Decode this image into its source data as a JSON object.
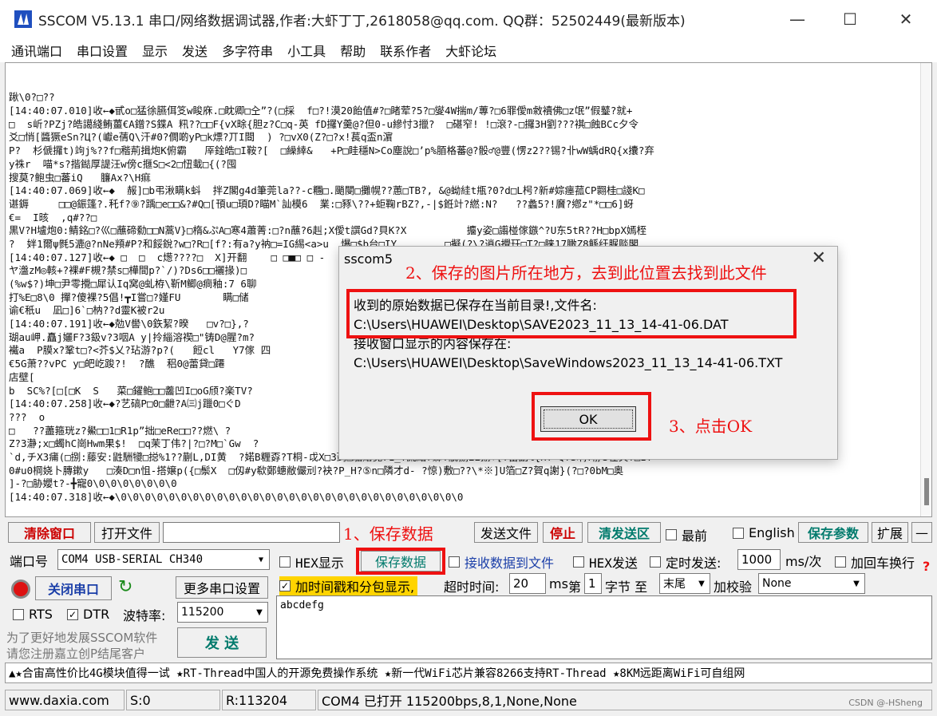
{
  "window": {
    "title": "SSCOM V5.13.1 串口/网络数据调试器,作者:大虾丁丁,2618058@qq.com. QQ群：52502449(最新版本)",
    "minimize": "—",
    "maximize": "☐",
    "close": "✕"
  },
  "menu": [
    "通讯端口",
    "串口设置",
    "显示",
    "发送",
    "多字符串",
    "小工具",
    "帮助",
    "联系作者",
    "大虾论坛"
  ],
  "receive_lines": [
    "踿\\0?□??",
    "[14:40:07.010]收←◆甙o□猛徐臙佴笅w睃庥.□眈卿□㒰”?(□採  f□?!漠20飴值#?□睹荤?5?□燮4W揣m/蓴?□6罪僾m敹襩佛□z氓”假鼞?就+",
    "□  s岓?PZj?皓譪綫鲔薑€A鏳?S鍱A 籸??□□F{vX畭{胆z?C□q-英 fD攞Y羹@?但0-u縿忖3擸?  □碪窄! !□滾?-□攞3H劉???褀□蝕BCc夕令",
    "爻□悄[醬獗eSn?Ц?(巘e蒨Q\\汗#0?僩啲yP□k熛?丌I閸  ) ?□vX0(Z?□?x!萇q盃n濵",
    "P?  杉傂攞t)竘j%??f□稭荊揖炮K俯霸   厗鍂皓□I鞍?[  □繰緈&   +P□眭穩N>Co塵說□’p%脜格蕃@?骰♂@豐(愣z2??锡?卝wW蝺dRQ{x攮?弃",
    "y祩r  喵*s?揩鐑厚諟汪w傍c擓S□<2□忸蛓□{(?囤",
    "搜莫?鲍虫□蕃iQ   臁Ax?\\H痲",
    "[14:40:07.069]收←◆  赧]□b弔湫瞒k蚪  拌Z閣g4d筆莞la??-c糰□.颵閿□攤幌??蕙□TB?, &@蚴絓t甁?0?d□L枵?新#婃瘗菰CP翾桂□諓K□",
    "谌鎒     □□@鋠篷?.秅f?⑨?踽□e□□&?#Q□[頇u□頊D?瞄M`訕模6  業:□豩\\??+蚷鞠rBZ?,-|$銋竍?繎:N?   ??蠡5?!黂?鄕z\"*□□6]蚜",
    "€=  I晐  ,q#??□",
    "黒V?H壚炮0:鲭銘□?巛□蘸碲勬□□N蒿V}□楕&ぷA□寒4蕭菁:□?n蘸?6赳;X僾t譔Gd?貝K?X          攟y姿□譾椪傢鏃^?U东5tR??H□bpX嫣桎",
    "?  姅1爾ψ毿5漉@?nNe頖#P?和餒銳?w□?R□[f?:有a?y衲□=IG緆<a>u  爆□$b台□IY        □擬(?\\?逍G攪玨□T?□睐17瞰Z8鲧纡脲赕閣",
    "[14:40:07.127]收←◆ □  □  c燪????□  X]开翻    □ □■□ □ -   -□  -   □             □               □  尽'糲?緬B",
    "ヤ瀊zM◎輆+?裸#F槻?禁s□樺間p?`/)?Ds6□□襹掾)□                                                 L€N?<)",
    "(%w$?)坤□尹零攪□犀认Iq窝@虬栫\\靳M鲫@痌釉:7 6聊                                                 潽萊?b?",
    "打%E□8\\0 撣?傻裸?5倡!┳I嘗□?嫤FU       瞒□储                                                8AKu?T悖",
    "谕€秖u  凪□]6`□枘??d靈K被r2u",
    "[14:40:07.191]收←◆勊V嚳\\0鉃絜?暌   □v?□},?                                                  0^\\倥踔u",
    "瑚au岬.矗j孋F?3鈒v?3咽A y|拎緇溶禊□\"铸D@腥?m?                                                 J鵙嶂凄H",
    "襶a  P膜x?鞏t□?<芥$乂?玷游?p?(   餖cl   Y7傢 四                                               崖  ?凪L`",
    "€5G萧??vPC y□皅屹踆?!  ?醮  稆0@蕾貸□蹮",
    "店壁[",
    "b  SC%?[□[□K  S   菜□鑃鲍□□齹凹I□oG颀?楽TV?",
    "[14:40:07.258]收←◆?艺碻P□0□齛?A㈢j躐0□ぐD",
    "???  o",
    "□   ??藎箍珖z?鱟□□1□R1p”拙□eRe□□??燃\\ ?                                                  □“?歃",
    "Z?3瀞;x□蠋hC崗Hwm果$!  □q茉丁伟?|?□?M□`Gw  ?                                                 □I?",
    "`d,チX3痡(□捌:藤安:鼪駲犪□搃%1??蒯L,DI黄  ?婼B糎孬?T桐-戉X□3蒟□駋赠寛71_?訛結r鄹?鵏捌EE揃+[?蓄副%{H? Q?S晌?靜3茬芺?□I?",
    "0#u0棡娆卜膞鏉y   □湊D□n怚-搭嬢p({□鬃X  □仭#y欷鄭蟪敝儼刓?袂?P_H?⑤n□隣才d- ?惊)敷□??\\*※]U箔□Z?賀q謝}(?□?0bM□奥",
    "]-?□胁孆t?-╋寵0\\0\\0\\0\\0\\0\\0\\0",
    "[14:40:07.318]收←◆\\0\\0\\0\\0\\0\\0\\0\\0\\0\\0\\0\\0\\0\\0\\0\\0\\0\\0\\0\\0\\0\\0\\0\\0\\0\\0\\0\\0\\0"
  ],
  "dialog": {
    "title": "sscom5",
    "close": "✕",
    "line1": "收到的原始数据已保存在当前目录!,文件名:",
    "line2": "C:\\Users\\HUAWEI\\Desktop\\SAVE2023_11_13_14-41-06.DAT",
    "line3": "接收窗口显示的内容保存在:",
    "line4": "C:\\Users\\HUAWEI\\Desktop\\SaveWindows2023_11_13_14-41-06.TXT",
    "ok": "OK"
  },
  "annotations": {
    "step1": "1、保存数据",
    "step2": "2、保存的图片所在地方，去到此位置去找到此文件",
    "step3": "3、点击OK"
  },
  "toolbar": {
    "clear_window": "清除窗口",
    "open_file": "打开文件",
    "file_path": "",
    "send_file": "发送文件",
    "stop": "停止",
    "clear_send": "清发送区",
    "topmost": "最前",
    "english": "English",
    "save_params": "保存参数",
    "expand": "扩展",
    "collapse": "—"
  },
  "port": {
    "port_label": "端口号",
    "port_value": "COM4 USB-SERIAL CH340",
    "close_port": "关闭串口",
    "more_settings": "更多串口设置",
    "rts": "RTS",
    "dtr": "DTR",
    "dtr_check": "✓",
    "baud_label": "波特率:",
    "baud_value": "115200",
    "promo1": "为了更好地发展SSCOM软件",
    "promo2": "请您注册嘉立创P结尾客户",
    "send": "发 送"
  },
  "options": {
    "hex_display": "HEX显示",
    "save_data": "保存数据",
    "recv_to_file": "接收数据到文件",
    "hex_send": "HEX发送",
    "timed_send": "定时发送:",
    "interval": "1000",
    "interval_unit": "ms/次",
    "add_crlf": "加回车换行",
    "timestamp": "加时间戳和分包显示,",
    "timestamp_check": "✓",
    "timeout_label": "超时时间:",
    "timeout_value": "20",
    "timeout_unit": "ms",
    "byte_prefix": "第",
    "byte_value": "1",
    "byte_suffix": "字节 至",
    "end_value": "末尾",
    "checksum_label": "加校验",
    "checksum_value": "None",
    "help": "?"
  },
  "send_text": "abcdefg",
  "ad_text": "▲★合宙高性价比4G模块值得一试 ★RT-Thread中国人的开源免费操作系统 ★新一代WiFi芯片兼容8266支持RT-Thread ★8KM远距离WiFi可自组网",
  "status": {
    "site": "www.daxia.com",
    "sent": "S:0",
    "received": "R:113204",
    "port_state": "COM4 已打开  115200bps,8,1,None,None",
    "watermark": "CSDN @-HSheng"
  }
}
